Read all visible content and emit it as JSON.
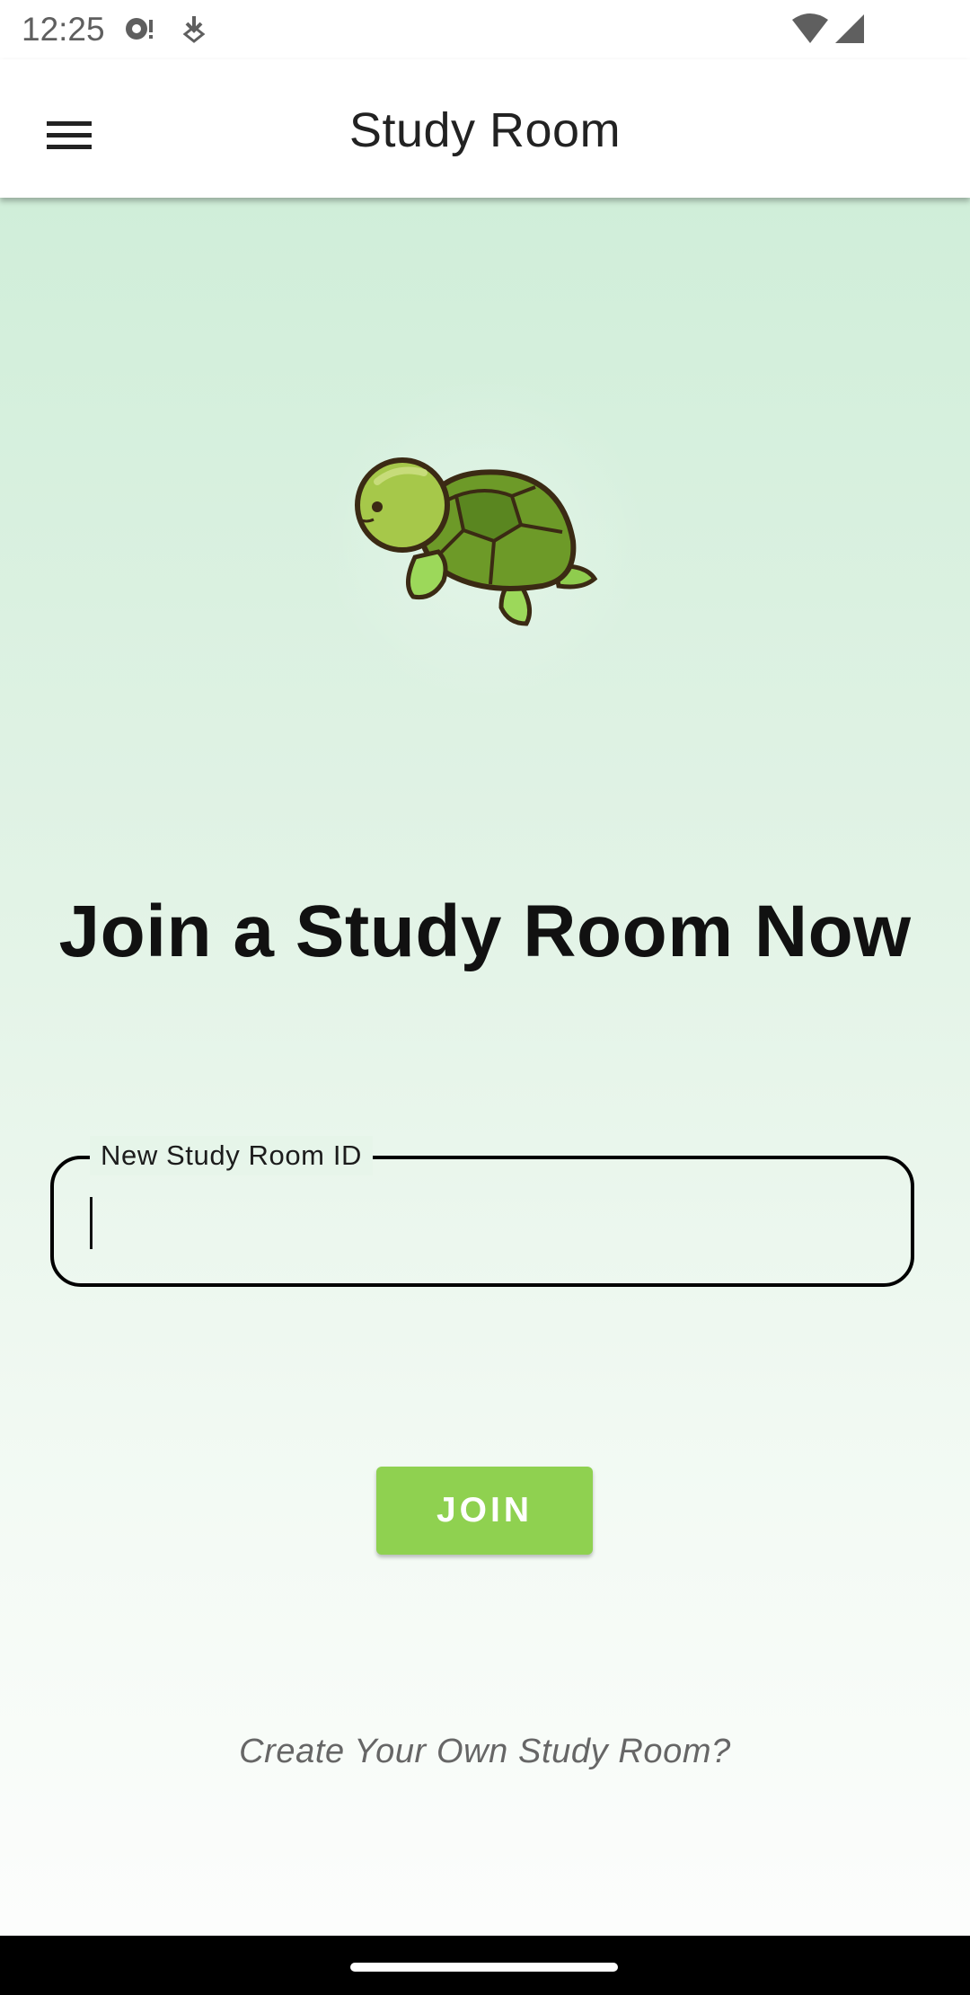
{
  "status_bar": {
    "time": "12:25",
    "icons": [
      "notification-dot-icon",
      "download-arrow-icon",
      "wifi-icon",
      "cellular-signal-icon"
    ]
  },
  "app_bar": {
    "title": "Study Room",
    "menu_icon": "hamburger-menu-icon"
  },
  "main": {
    "illustration": "turtle-illustration",
    "headline": "Join a Study Room Now",
    "room_id_field": {
      "label": "New Study Room ID",
      "value": ""
    },
    "join_button_label": "JOIN",
    "create_link_label": "Create Your Own Study Room?"
  },
  "colors": {
    "accent": "#8fd150",
    "background_top": "#d0eed9",
    "background_bottom": "#fcfdfc"
  }
}
